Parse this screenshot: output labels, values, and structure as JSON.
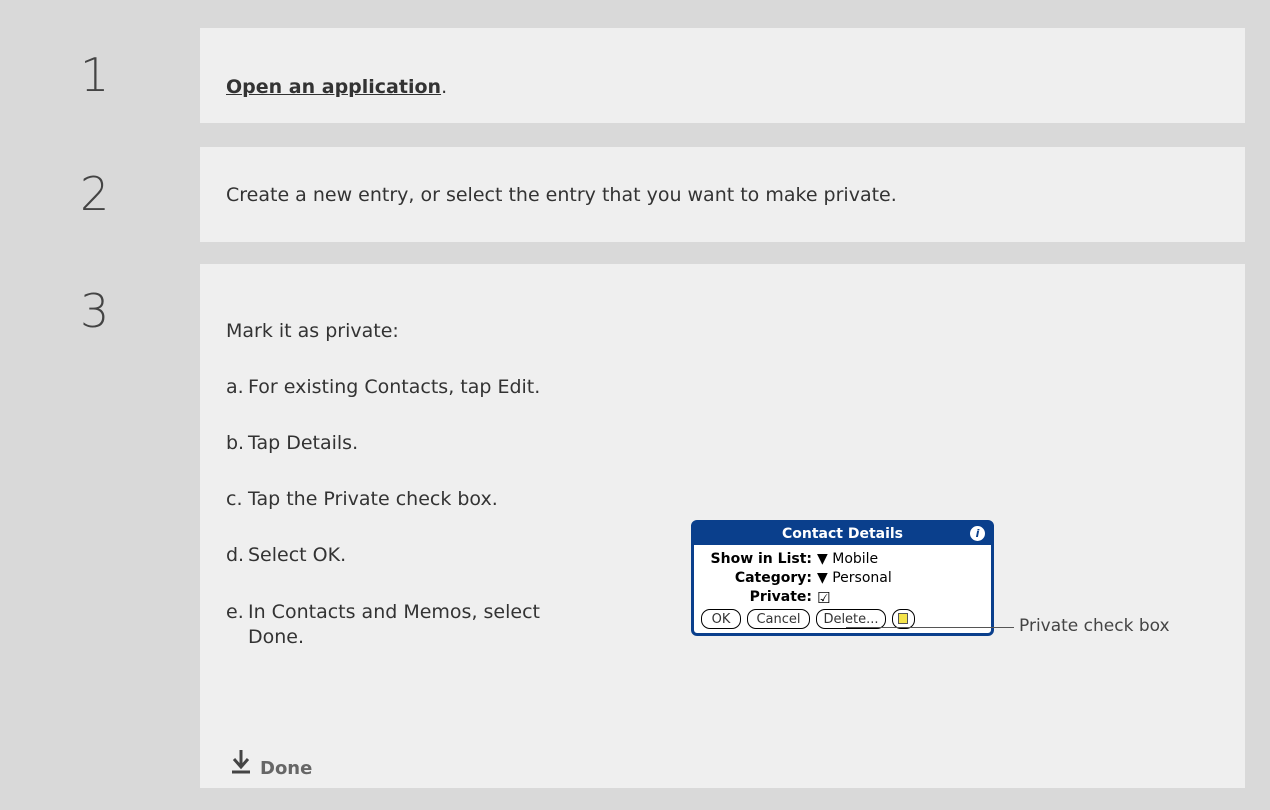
{
  "steps": [
    {
      "number": "1",
      "link_text": "Open an application",
      "after_link": "."
    },
    {
      "number": "2",
      "text": "Create a new entry, or select the entry that you want to make private."
    },
    {
      "number": "3",
      "intro": "Mark it as private:",
      "substeps": [
        {
          "letter": "a.",
          "text": "For existing Contacts, tap Edit."
        },
        {
          "letter": "b.",
          "text": "Tap Details."
        },
        {
          "letter": "c.",
          "text": "Tap the Private check box."
        },
        {
          "letter": "d.",
          "text": "Select OK."
        },
        {
          "letter": "e.",
          "text_line1": "In Contacts and Memos, select",
          "text_line2": "Done."
        }
      ],
      "done_label": "Done"
    }
  ],
  "dialog": {
    "title": "Contact Details",
    "show_in_list_label": "Show in List:",
    "show_in_list_value": "Mobile",
    "category_label": "Category:",
    "category_value": "Personal",
    "private_label": "Private:",
    "private_checked": true,
    "buttons": [
      "OK",
      "Cancel",
      "Delete..."
    ],
    "callout": "Private check box"
  },
  "colors": {
    "dialog_blue": "#0a3f8c",
    "number_column": "#d9d9d9",
    "content_bg": "#efefef"
  }
}
